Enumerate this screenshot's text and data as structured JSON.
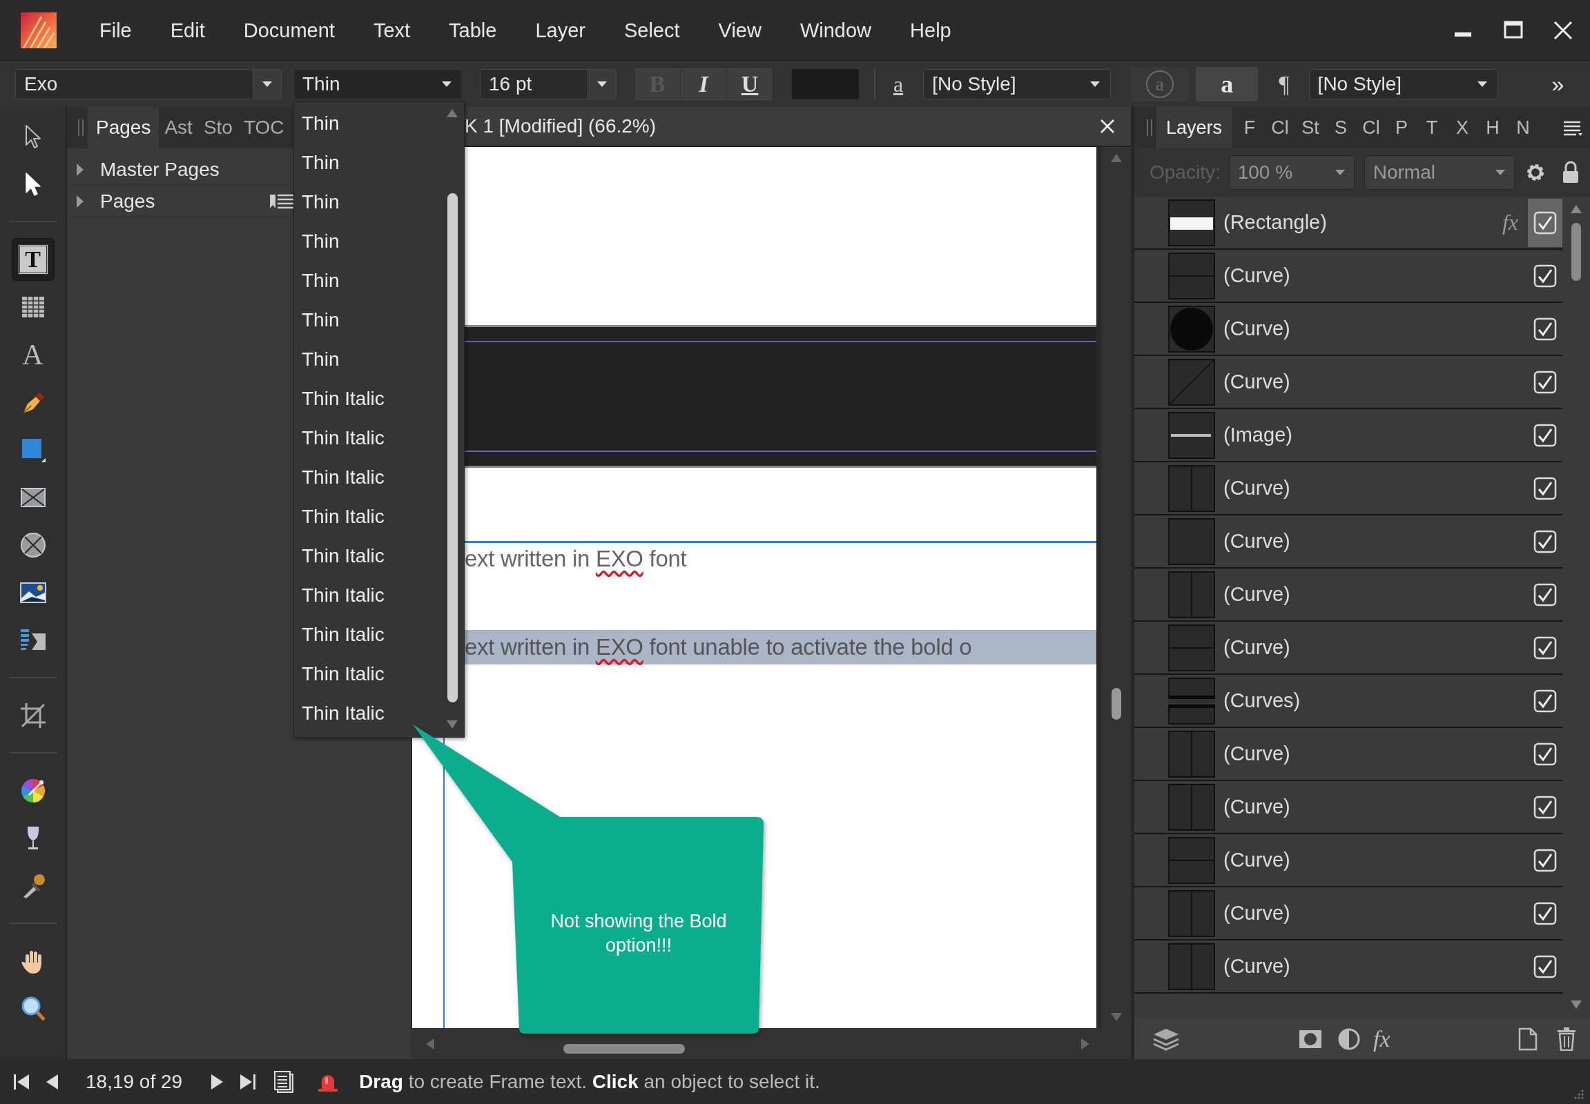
{
  "menu_bar": {
    "items": [
      "File",
      "Edit",
      "Document",
      "Text",
      "Table",
      "Layer",
      "Select",
      "View",
      "Window",
      "Help"
    ]
  },
  "toolbar": {
    "font_family": "Exo",
    "font_weight": "Thin",
    "font_size": "16 pt",
    "format_buttons": [
      {
        "label": "B",
        "kind": "bold",
        "disabled": true
      },
      {
        "label": "I",
        "kind": "italic",
        "disabled": false
      },
      {
        "label": "U",
        "kind": "underline",
        "disabled": false
      }
    ],
    "character_style_label": "a",
    "character_style": "[No Style]",
    "style_buttons": [
      {
        "label": "a",
        "kind": "circled",
        "disabled": true
      },
      {
        "label": "a",
        "kind": "plain",
        "disabled": false
      }
    ],
    "paragraph_label": "¶",
    "paragraph_style": "[No Style]",
    "overflow_label": "»"
  },
  "tools": [
    {
      "kind": "pointer",
      "selected": false
    },
    {
      "kind": "node",
      "selected": false
    },
    {
      "kind": "separator"
    },
    {
      "kind": "frame-text",
      "glyph": "T",
      "selected": true
    },
    {
      "kind": "table",
      "selected": false
    },
    {
      "kind": "artistic-text",
      "glyph": "A",
      "selected": false
    },
    {
      "kind": "pen",
      "selected": false
    },
    {
      "kind": "rectangle",
      "selected": false
    },
    {
      "kind": "picture-frame",
      "selected": false
    },
    {
      "kind": "ellipse-frame",
      "selected": false
    },
    {
      "kind": "image",
      "selected": false
    },
    {
      "kind": "text-flow",
      "selected": false
    },
    {
      "kind": "separator"
    },
    {
      "kind": "crop",
      "selected": false
    },
    {
      "kind": "separator"
    },
    {
      "kind": "color-wheel",
      "selected": false
    },
    {
      "kind": "fill",
      "selected": false
    },
    {
      "kind": "eyedropper",
      "selected": false
    },
    {
      "kind": "separator"
    },
    {
      "kind": "hand",
      "selected": false
    },
    {
      "kind": "zoom",
      "selected": false
    }
  ],
  "pages_panel": {
    "tabs": [
      {
        "label": "Pages",
        "selected": true
      },
      {
        "label": "Ast",
        "selected": false
      },
      {
        "label": "Sto",
        "selected": false
      },
      {
        "label": "TOC",
        "selected": false
      }
    ],
    "sections": [
      {
        "label": "Master Pages",
        "expanded": false
      },
      {
        "label": "Pages",
        "expanded": false
      }
    ]
  },
  "weight_dropdown": {
    "options": [
      {
        "label": "Thin",
        "selected": false
      },
      {
        "label": "Thin",
        "selected": false
      },
      {
        "label": "Thin",
        "selected": false
      },
      {
        "label": "Thin",
        "selected": false
      },
      {
        "label": "Thin",
        "selected": false
      },
      {
        "label": "Thin",
        "selected": false
      },
      {
        "label": "Thin",
        "selected": false
      },
      {
        "label": "Thin Italic",
        "selected": false
      },
      {
        "label": "Thin Italic",
        "selected": false
      },
      {
        "label": "Thin Italic",
        "selected": false
      },
      {
        "label": "Thin Italic",
        "selected": false
      },
      {
        "label": "Thin Italic",
        "selected": false
      },
      {
        "label": "Thin Italic",
        "selected": false
      },
      {
        "label": "Thin Italic",
        "selected": false
      },
      {
        "label": "Thin Italic",
        "selected": false
      },
      {
        "label": "Thin Italic",
        "selected": false
      }
    ]
  },
  "document": {
    "title": "K 1 [Modified] (66.2%)",
    "lines": [
      {
        "selected": false,
        "segments": [
          {
            "text": "ext written in ",
            "misspelled": false
          },
          {
            "text": "EXO",
            "misspelled": true
          },
          {
            "text": " font",
            "misspelled": false
          }
        ]
      },
      {
        "selected": true,
        "segments": [
          {
            "text": "ext written in ",
            "misspelled": false
          },
          {
            "text": "EXO",
            "misspelled": true
          },
          {
            "text": " font unable to activate the bold o",
            "misspelled": false
          }
        ]
      }
    ]
  },
  "layers_panel": {
    "tabs": [
      {
        "label": "Layers",
        "selected": true
      },
      {
        "label": "F",
        "selected": false
      },
      {
        "label": "Cl",
        "selected": false
      },
      {
        "label": "St",
        "selected": false
      },
      {
        "label": "S",
        "selected": false
      },
      {
        "label": "Cl",
        "selected": false
      },
      {
        "label": "P",
        "selected": false
      },
      {
        "label": "T",
        "selected": false
      },
      {
        "label": "X",
        "selected": false
      },
      {
        "label": "H",
        "selected": false
      },
      {
        "label": "N",
        "selected": false
      }
    ],
    "opacity_label": "Opacity:",
    "opacity_disabled": true,
    "opacity": "100 %",
    "blend_mode": "Normal",
    "layers": [
      {
        "name": "(Rectangle)",
        "kind": "white-bar",
        "fx_label": "fx",
        "hovered": true,
        "visible": true
      },
      {
        "name": "(Curve)",
        "kind": "hline",
        "hovered": false,
        "visible": true
      },
      {
        "name": "(Curve)",
        "kind": "circle",
        "hovered": false,
        "visible": true
      },
      {
        "name": "(Curve)",
        "kind": "diagonal",
        "hovered": false,
        "visible": true
      },
      {
        "name": "(Image)",
        "kind": "image",
        "hovered": false,
        "visible": true
      },
      {
        "name": "(Curve)",
        "kind": "vline",
        "hovered": false,
        "visible": true
      },
      {
        "name": "(Curve)",
        "kind": "blank",
        "hovered": false,
        "visible": true
      },
      {
        "name": "(Curve)",
        "kind": "vline",
        "hovered": false,
        "visible": true
      },
      {
        "name": "(Curve)",
        "kind": "hline",
        "hovered": false,
        "visible": true
      },
      {
        "name": "(Curves)",
        "kind": "bars",
        "hovered": false,
        "visible": true
      },
      {
        "name": "(Curve)",
        "kind": "vline",
        "hovered": false,
        "visible": true
      },
      {
        "name": "(Curve)",
        "kind": "vline",
        "hovered": false,
        "visible": true
      },
      {
        "name": "(Curve)",
        "kind": "hline",
        "hovered": false,
        "visible": true
      },
      {
        "name": "(Curve)",
        "kind": "vline",
        "hovered": false,
        "visible": true
      },
      {
        "name": "(Curve)",
        "kind": "vline",
        "hovered": false,
        "visible": true
      }
    ],
    "effects_label": "fx"
  },
  "status_bar": {
    "page_info": "18,19 of 29",
    "hint": "**Drag** to create Frame text. **Click** an object to select it."
  },
  "callout": {
    "text": "Not showing the Bold option!!!"
  }
}
